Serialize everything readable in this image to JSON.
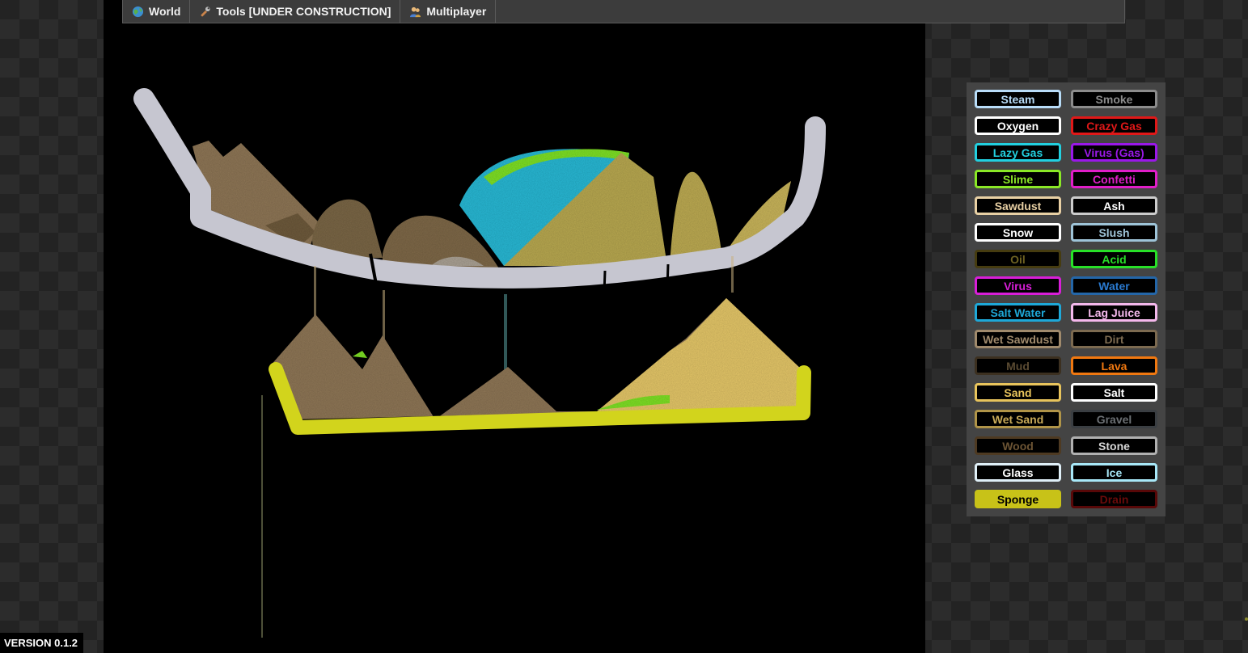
{
  "menu": {
    "items": [
      {
        "label": "World",
        "icon": "globe-icon"
      },
      {
        "label": "Tools [UNDER CONSTRUCTION]",
        "icon": "wrench-icon"
      },
      {
        "label": "Multiplayer",
        "icon": "users-icon"
      }
    ]
  },
  "version": "VERSION 0.1.2",
  "elements": [
    {
      "label": "Steam",
      "color": "#b8dcf8",
      "text": "#b8dcf8"
    },
    {
      "label": "Smoke",
      "color": "#8c8c8c",
      "text": "#8c8c8c"
    },
    {
      "label": "Oxygen",
      "color": "#ffffff",
      "text": "#ffffff"
    },
    {
      "label": "Crazy Gas",
      "color": "#e01818",
      "text": "#e01818"
    },
    {
      "label": "Lazy Gas",
      "color": "#22d0e0",
      "text": "#22d0e0"
    },
    {
      "label": "Virus (Gas)",
      "color": "#9a18e8",
      "text": "#9a18e8"
    },
    {
      "label": "Slime",
      "color": "#8ae826",
      "text": "#8ae826"
    },
    {
      "label": "Confetti",
      "color": "#e01ec8",
      "text": "#e01ec8"
    },
    {
      "label": "Sawdust",
      "color": "#e8d0a4",
      "text": "#e8d0a4"
    },
    {
      "label": "Ash",
      "color": "#cccccc",
      "text": "#ffffff"
    },
    {
      "label": "Snow",
      "color": "#ffffff",
      "text": "#ffffff"
    },
    {
      "label": "Slush",
      "color": "#9ec4d8",
      "text": "#9ec4d8"
    },
    {
      "label": "Oil",
      "color": "#463c10",
      "text": "#6e6222"
    },
    {
      "label": "Acid",
      "color": "#28e028",
      "text": "#28e028"
    },
    {
      "label": "Virus",
      "color": "#d81ed8",
      "text": "#d81ed8"
    },
    {
      "label": "Water",
      "color": "#2466a8",
      "text": "#2a7ad0"
    },
    {
      "label": "Salt Water",
      "color": "#1ea8d8",
      "text": "#1ea8d8"
    },
    {
      "label": "Lag Juice",
      "color": "#f4b8ec",
      "text": "#f4b8ec"
    },
    {
      "label": "Wet Sawdust",
      "color": "#a08a6c",
      "text": "#a08a6c"
    },
    {
      "label": "Dirt",
      "color": "#7c6a50",
      "text": "#7c6a50"
    },
    {
      "label": "Mud",
      "color": "#3c3020",
      "text": "#5a4a32"
    },
    {
      "label": "Lava",
      "color": "#f07810",
      "text": "#f07810"
    },
    {
      "label": "Sand",
      "color": "#e8c45c",
      "text": "#e8c45c"
    },
    {
      "label": "Salt",
      "color": "#ffffff",
      "text": "#ffffff"
    },
    {
      "label": "Wet Sand",
      "color": "#b09448",
      "text": "#c8aa58"
    },
    {
      "label": "Gravel",
      "color": "#3a3e42",
      "text": "#6c7074"
    },
    {
      "label": "Wood",
      "color": "#4e3a22",
      "text": "#6c5434"
    },
    {
      "label": "Stone",
      "color": "#b0b0b0",
      "text": "#d8d8d8"
    },
    {
      "label": "Glass",
      "color": "#e0f0f8",
      "text": "#ffffff"
    },
    {
      "label": "Ice",
      "color": "#a8e8f8",
      "text": "#a8e8f8"
    },
    {
      "label": "Sponge",
      "color": "#c8c218",
      "text": "#000000",
      "selected": true
    },
    {
      "label": "Drain",
      "color": "#580808",
      "text": "#6a0a0a"
    }
  ]
}
